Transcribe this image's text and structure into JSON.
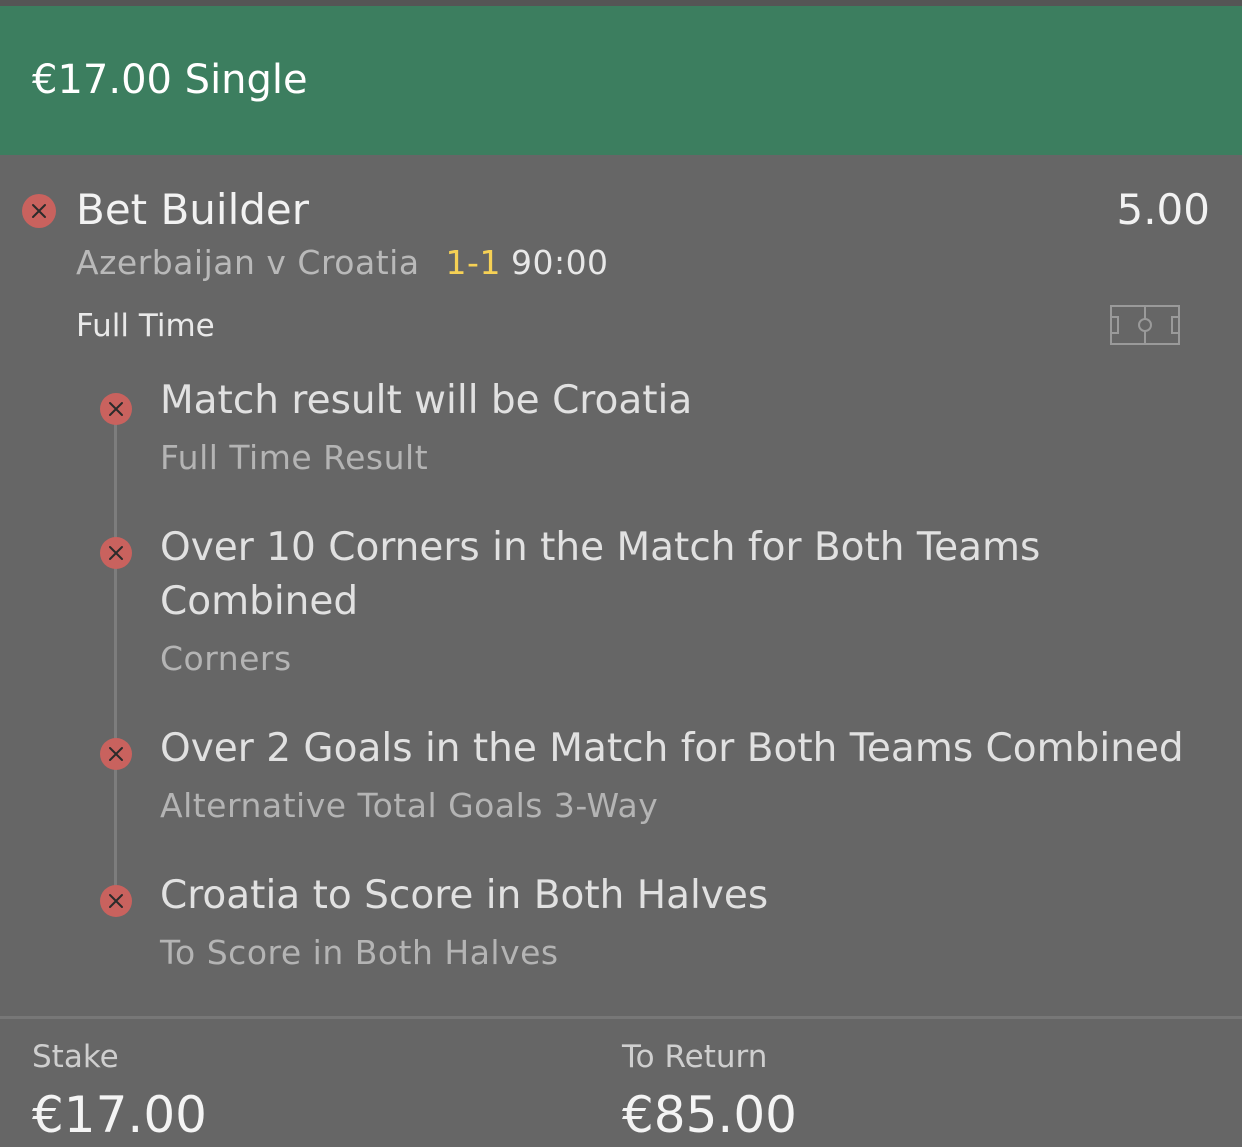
{
  "header": {
    "title": "€17.00 Single",
    "color": "#3c7e5f"
  },
  "bet": {
    "title": "Bet Builder",
    "odds": "5.00",
    "event": "Azerbaijan v Croatia",
    "score": "1-1",
    "time": "90:00",
    "period": "Full Time",
    "pitch_icon": "football-pitch-icon"
  },
  "selections": [
    {
      "title": "Match result will be Croatia",
      "market": "Full Time Result"
    },
    {
      "title_line1": "Over 10 Corners in the Match for Both Teams",
      "title_line2": "Combined",
      "market": "Corners"
    },
    {
      "title": "Over 2 Goals in the Match for Both Teams Combined",
      "market": "Alternative Total Goals 3-Way"
    },
    {
      "title": "Croatia to Score in Both Halves",
      "market": "To Score in Both Halves"
    }
  ],
  "status_icon": "lost-x-icon",
  "status_color": "#c9625e",
  "score_color": "#f6d155",
  "footer": {
    "stake_label": "Stake",
    "stake_value": "€17.00",
    "return_label": "To Return",
    "return_value": "€85.00"
  }
}
